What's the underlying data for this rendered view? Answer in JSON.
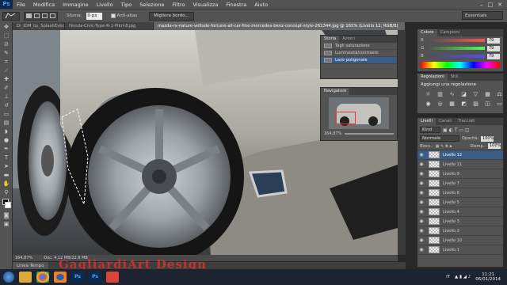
{
  "menu": {
    "app_icon": "Ps",
    "items": [
      "File",
      "Modifica",
      "Immagine",
      "Livello",
      "Tipo",
      "Selezione",
      "Filtro",
      "Visualizza",
      "Finestra",
      "Aiuto"
    ],
    "window_controls": [
      "–",
      "□",
      "✕"
    ]
  },
  "options": {
    "sfuma_label": "Sfuma:",
    "sfuma_value": "0 px",
    "antialias_label": "Anti-alias",
    "refine_button": "Migliora bordo..."
  },
  "workspace": {
    "label": "Essentials"
  },
  "tabs": [
    {
      "label": "Di_IDM_by_SplashEvbo.jpg"
    },
    {
      "label": "Honda-Civic-Type-R-1-Pikrl-8.jpg"
    },
    {
      "label": "mazda-rx-nature-veltsde-fortune-all-car-fine-mercedes-benz-concept-style-261344.jpg @ 165% (Livello 12, RGB/8)"
    }
  ],
  "status": {
    "zoom": "164,87%",
    "doc": "Doc: 4,12 MB/22,8 MB"
  },
  "timeline": {
    "label": "Linea Tempo"
  },
  "watermark": {
    "text": "GagliardiArt Design"
  },
  "history": {
    "tabs": [
      "Storia",
      "Azioni"
    ],
    "items": [
      {
        "label": "Tagli saturazione",
        "selected": false
      },
      {
        "label": "Luminosità/contrasto",
        "selected": false
      },
      {
        "label": "Lazo poligonale",
        "selected": true
      }
    ]
  },
  "navigator": {
    "title": "Navigatore",
    "zoom": "164,87%"
  },
  "color": {
    "tabs": [
      "Colore",
      "Campioni"
    ],
    "r": "79",
    "g": "79",
    "b": "79"
  },
  "adjustments": {
    "tabs": [
      "Regolazioni",
      "Stili"
    ],
    "title": "Aggiungi una regolazione",
    "icons": [
      "brightness-icon",
      "levels-icon",
      "curves-icon",
      "exposure-icon",
      "vibrance-icon",
      "hue-icon",
      "balance-icon",
      "bw-icon",
      "photo-filter-icon",
      "channel-mixer-icon",
      "lookup-icon",
      "invert-icon",
      "posterize-icon",
      "threshold-icon",
      "gradient-map-icon",
      "selective-color-icon"
    ]
  },
  "layers": {
    "tabs": [
      "Livelli",
      "Canali",
      "Tracciati"
    ],
    "kind": "Kind",
    "blend": "Normale",
    "opacity_label": "Opacità:",
    "opacity": "100%",
    "lock_label": "Blocc.:",
    "fill_label": "Riemp.:",
    "fill": "100%",
    "items": [
      {
        "name": "Livello 12",
        "selected": true
      },
      {
        "name": "Livello 11",
        "selected": false
      },
      {
        "name": "Livello 9",
        "selected": false
      },
      {
        "name": "Livello 7",
        "selected": false
      },
      {
        "name": "Livello 6",
        "selected": false
      },
      {
        "name": "Livello 5",
        "selected": false
      },
      {
        "name": "Livello 4",
        "selected": false
      },
      {
        "name": "Livello 3",
        "selected": false
      },
      {
        "name": "Livello 2",
        "selected": false
      },
      {
        "name": "Livello 10",
        "selected": false
      },
      {
        "name": "Livello 1",
        "selected": false
      }
    ]
  },
  "taskbar": {
    "tray_lang": "IT",
    "time": "11:21",
    "date": "06/01/2014"
  }
}
